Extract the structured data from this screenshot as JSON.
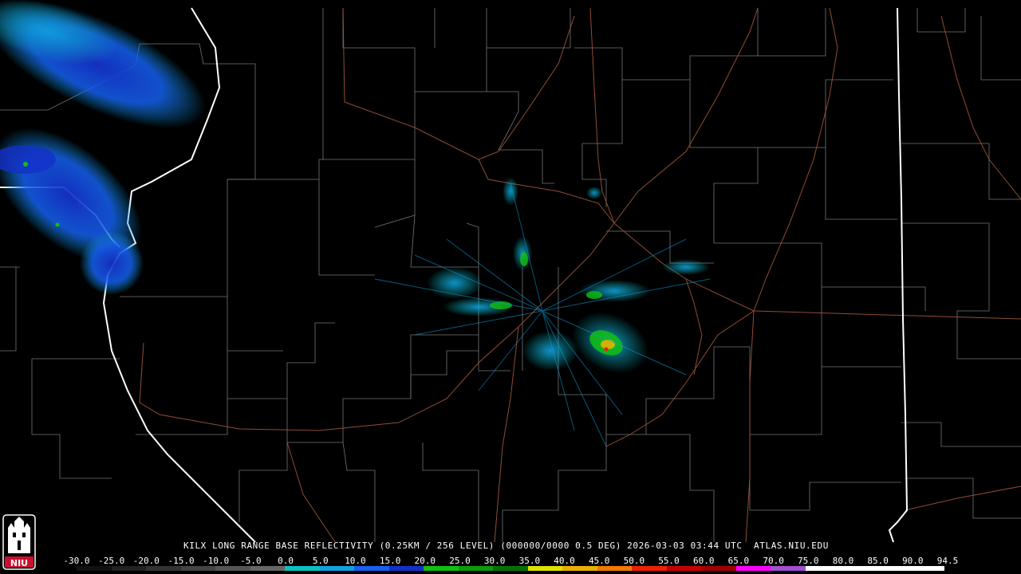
{
  "caption": "KILX LONG RANGE BASE REFLECTIVITY (0.25KM / 256 LEVEL) (000000/0000 0.5 DEG) 2026-03-03 03:44 UTC  ATLAS.NIU.EDU",
  "legend": {
    "labels": [
      "-30.0",
      "-25.0",
      "-20.0",
      "-15.0",
      "-10.0",
      "-5.0",
      "0.0",
      "5.0",
      "10.0",
      "15.0",
      "20.0",
      "25.0",
      "30.0",
      "35.0",
      "40.0",
      "45.0",
      "50.0",
      "55.0",
      "60.0",
      "65.0",
      "70.0",
      "75.0",
      "80.0",
      "85.0",
      "90.0",
      "94.5"
    ],
    "colors": [
      "#111111",
      "#222222",
      "#333333",
      "#444444",
      "#555555",
      "#666666",
      "#0cc0c0",
      "#10a0e0",
      "#1560f0",
      "#1430c8",
      "#10c010",
      "#0a9a0a",
      "#067006",
      "#e0e000",
      "#e8b000",
      "#f07800",
      "#f02000",
      "#c80000",
      "#a00000",
      "#ff00ff",
      "#a050d0",
      "#ffffff",
      "#ffffff",
      "#ffffff",
      "#ffffff"
    ]
  },
  "logo": {
    "text": "NIU",
    "color": "#c8102e"
  }
}
